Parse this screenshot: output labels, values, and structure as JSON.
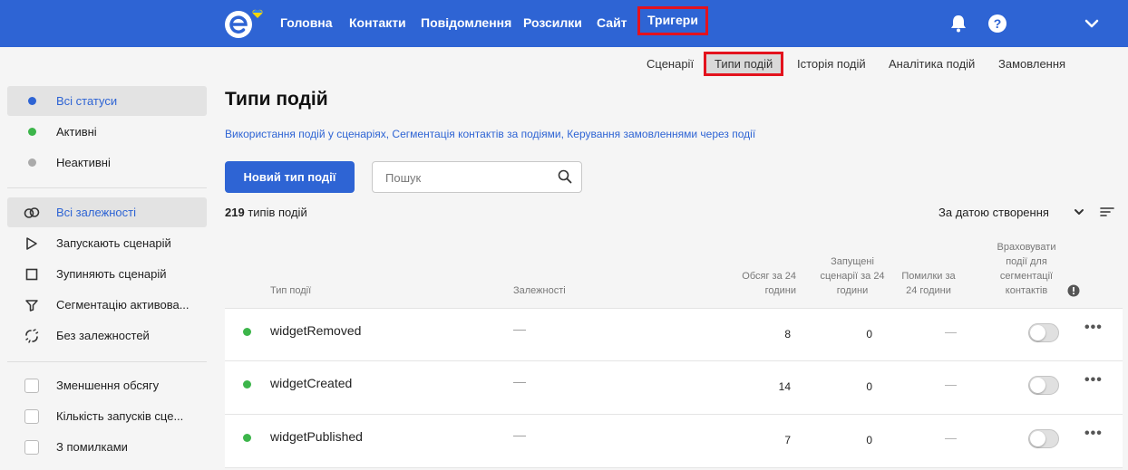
{
  "nav": {
    "items": [
      {
        "label": "Головна"
      },
      {
        "label": "Контакти"
      },
      {
        "label": "Повідомлення"
      },
      {
        "label": "Розсилки"
      },
      {
        "label": "Сайт"
      },
      {
        "label": "Тригери",
        "active": true
      }
    ],
    "icons": [
      "bell-icon",
      "help-icon",
      "chevron-down-icon"
    ]
  },
  "subtabs": [
    {
      "label": "Сценарії"
    },
    {
      "label": "Типи подій",
      "active": true
    },
    {
      "label": "Історія подій"
    },
    {
      "label": "Аналітика подій"
    },
    {
      "label": "Замовлення"
    }
  ],
  "sidebar": {
    "status": [
      {
        "label": "Всі статуси",
        "color": "#2e64d4",
        "active": true
      },
      {
        "label": "Активні",
        "color": "#3cb54a"
      },
      {
        "label": "Неактивні",
        "color": "#aaaaaa"
      }
    ],
    "dependencies": [
      {
        "label": "Всі залежності",
        "icon": "link-icon",
        "active": true
      },
      {
        "label": "Запускають сценарій",
        "icon": "play-icon"
      },
      {
        "label": "Зупиняють сценарій",
        "icon": "stop-icon"
      },
      {
        "label": "Сегментацію активова...",
        "icon": "filter-icon"
      },
      {
        "label": "Без залежностей",
        "icon": "unlinked-icon"
      }
    ],
    "filters": [
      {
        "label": "Зменшення обсягу"
      },
      {
        "label": "Кількість запусків сце..."
      },
      {
        "label": "З помилками"
      }
    ]
  },
  "main": {
    "title": "Типи подій",
    "help_links": "Використання подій у сценаріях, Сегментація контактів за подіями, Керування замовленнями через події",
    "new_button": "Новий тип події",
    "search_placeholder": "Пошук",
    "count_number": "219",
    "count_label": "типів подій",
    "sort_label": "За датою створення"
  },
  "table": {
    "headers": {
      "type": "Тип події",
      "deps": "Залежності",
      "volume": "Обсяг за 24 години",
      "runs": "Запущені сценарії за 24 години",
      "errors": "Помилки за 24 години",
      "segmentation": "Враховувати події для сегментації контактів"
    },
    "rows": [
      {
        "name": "widgetRemoved",
        "deps": "—",
        "volume": "8",
        "runs": "0",
        "errors": "—",
        "segmentation": false
      },
      {
        "name": "widgetCreated",
        "deps": "—",
        "volume": "14",
        "runs": "0",
        "errors": "—",
        "segmentation": false
      },
      {
        "name": "widgetPublished",
        "deps": "—",
        "volume": "7",
        "runs": "0",
        "errors": "—",
        "segmentation": false
      }
    ]
  },
  "colors": {
    "brand": "#2e64d4",
    "highlight": "#e3121d",
    "active_green": "#3cb54a"
  }
}
